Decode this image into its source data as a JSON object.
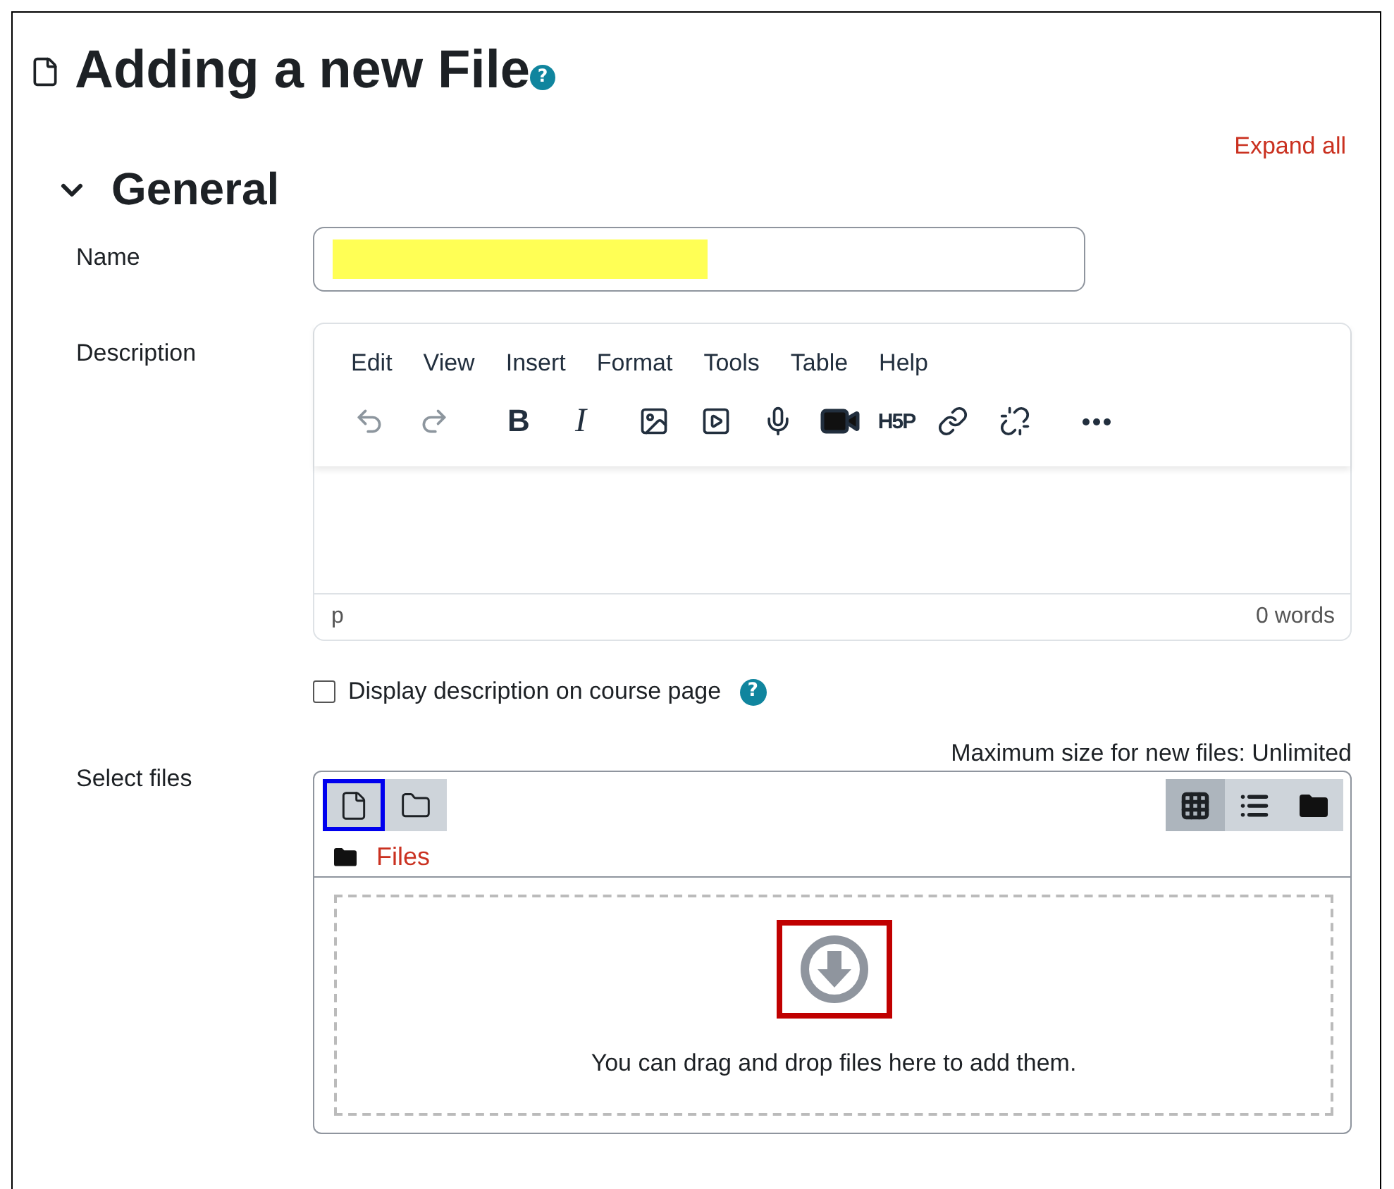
{
  "page": {
    "title": "Adding a new File",
    "help_icon": "?"
  },
  "expand_all": "Expand all",
  "section": {
    "title": "General",
    "expanded": true
  },
  "name_field": {
    "label": "Name",
    "redacted": true
  },
  "description": {
    "label": "Description",
    "menu": [
      "Edit",
      "View",
      "Insert",
      "Format",
      "Tools",
      "Table",
      "Help"
    ],
    "toolbar": [
      {
        "kind": "undo",
        "disabled": true
      },
      {
        "kind": "redo",
        "disabled": true
      },
      {
        "kind": "bold",
        "label": "B",
        "disabled": false
      },
      {
        "kind": "italic",
        "label": "I",
        "disabled": false
      },
      {
        "kind": "image",
        "disabled": false
      },
      {
        "kind": "media",
        "disabled": false
      },
      {
        "kind": "mic",
        "disabled": false
      },
      {
        "kind": "video",
        "disabled": false
      },
      {
        "kind": "h5p",
        "label": "H5P",
        "disabled": false
      },
      {
        "kind": "link",
        "disabled": false
      },
      {
        "kind": "unlink",
        "disabled": false
      },
      {
        "kind": "more",
        "disabled": false
      }
    ],
    "path": "p",
    "word_count": "0 words"
  },
  "display_checkbox": {
    "label": "Display description on course page",
    "checked": false,
    "help_icon": "?"
  },
  "select_files": {
    "label": "Select files",
    "max_size": "Maximum size for new files: Unlimited",
    "actions": [
      {
        "kind": "add-file",
        "color": "#0000ee"
      },
      {
        "kind": "new-folder"
      }
    ],
    "views": [
      {
        "kind": "grid",
        "selected": true
      },
      {
        "kind": "list",
        "selected": false
      },
      {
        "kind": "tree",
        "selected": false
      }
    ],
    "path": "Files",
    "drop_text": "You can drag and drop files here to add them.",
    "drop_annotation": {
      "color": "#c00000"
    }
  }
}
